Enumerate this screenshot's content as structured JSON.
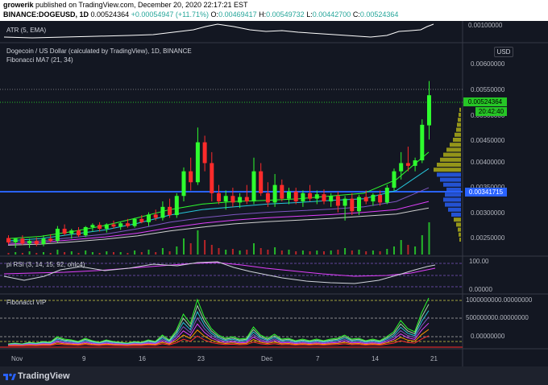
{
  "header": {
    "author": "growerik",
    "published_text": "published on TradingView.com, December 20, 2020 22:17:21 EST",
    "symbol": "BINANCE:DOGEUSD, 1D",
    "last_price": "0.00524364",
    "change": "+0.00054947 (+11.71%)",
    "open_label": "O:",
    "open": "0.00469417",
    "high_label": "H:",
    "high": "0.00549732",
    "low_label": "L:",
    "low": "0.00442700",
    "close_label": "C:",
    "close": "0.00524364"
  },
  "atr_panel": {
    "label": "ATR (5, EMA)",
    "right_label": "0.00100000"
  },
  "main_panel": {
    "title": "Dogecoin / US Dollar (calculated by TradingView), 1D, BINANCE",
    "indicator": "Fibonacci MA7 (21, 34)",
    "currency_button": "USD",
    "price_badge": "0.00524364",
    "time_badge": "20:42:40",
    "poc_badge": "0.00341715",
    "y_labels": [
      "0.00600000",
      "0.00550000",
      "0.00500000",
      "0.00450000",
      "0.00400000",
      "0.00350000",
      "0.00300000",
      "0.00250000"
    ],
    "y_partial_label": "0."
  },
  "rsi_panel": {
    "label": "pi RSI (3, 14, 15, 92, ohlc4)",
    "top_label": "100.00",
    "bottom_label": "0.00000"
  },
  "vip_panel": {
    "label": "Fibonacci VIP",
    "top_label": "1000000000.00000000",
    "mid_label": "500000000.00000000",
    "bottom_label": "0.00000000"
  },
  "time_axis": [
    "Nov",
    "9",
    "16",
    "23",
    "Dec",
    "7",
    "14",
    "21"
  ],
  "footer": {
    "brand": "TradingView"
  },
  "colors": {
    "up": "#2efc2e",
    "down": "#ff2b2b",
    "background": "#131722",
    "poc": "#2962ff",
    "profile": "#b5b518"
  },
  "chart_data": {
    "type": "candlestick",
    "y_range": [
      0.0023,
      0.0062
    ],
    "candles": [
      {
        "o": 0.00263,
        "h": 0.00268,
        "l": 0.00252,
        "c": 0.00255
      },
      {
        "o": 0.00255,
        "h": 0.00262,
        "l": 0.00245,
        "c": 0.00262
      },
      {
        "o": 0.00262,
        "h": 0.00268,
        "l": 0.0025,
        "c": 0.00253
      },
      {
        "o": 0.00253,
        "h": 0.00262,
        "l": 0.00245,
        "c": 0.00258
      },
      {
        "o": 0.00258,
        "h": 0.00264,
        "l": 0.00248,
        "c": 0.00252
      },
      {
        "o": 0.00252,
        "h": 0.00268,
        "l": 0.00248,
        "c": 0.00262
      },
      {
        "o": 0.00262,
        "h": 0.0027,
        "l": 0.00255,
        "c": 0.00258
      },
      {
        "o": 0.00258,
        "h": 0.00285,
        "l": 0.00255,
        "c": 0.0028
      },
      {
        "o": 0.0028,
        "h": 0.00288,
        "l": 0.00268,
        "c": 0.00271
      },
      {
        "o": 0.00271,
        "h": 0.0028,
        "l": 0.00262,
        "c": 0.00277
      },
      {
        "o": 0.00277,
        "h": 0.00283,
        "l": 0.00265,
        "c": 0.00268
      },
      {
        "o": 0.00268,
        "h": 0.00285,
        "l": 0.00265,
        "c": 0.00283
      },
      {
        "o": 0.00283,
        "h": 0.0029,
        "l": 0.00275,
        "c": 0.00287
      },
      {
        "o": 0.00287,
        "h": 0.00292,
        "l": 0.00275,
        "c": 0.0028
      },
      {
        "o": 0.0028,
        "h": 0.0029,
        "l": 0.00273,
        "c": 0.00288
      },
      {
        "o": 0.00288,
        "h": 0.00295,
        "l": 0.0028,
        "c": 0.00284
      },
      {
        "o": 0.00284,
        "h": 0.00292,
        "l": 0.00278,
        "c": 0.0029
      },
      {
        "o": 0.0029,
        "h": 0.00298,
        "l": 0.00282,
        "c": 0.00285
      },
      {
        "o": 0.00285,
        "h": 0.003,
        "l": 0.00282,
        "c": 0.00298
      },
      {
        "o": 0.00298,
        "h": 0.00305,
        "l": 0.0029,
        "c": 0.00292
      },
      {
        "o": 0.00292,
        "h": 0.0031,
        "l": 0.00285,
        "c": 0.00306
      },
      {
        "o": 0.00306,
        "h": 0.00315,
        "l": 0.00295,
        "c": 0.003
      },
      {
        "o": 0.003,
        "h": 0.0033,
        "l": 0.00295,
        "c": 0.0032
      },
      {
        "o": 0.0032,
        "h": 0.00335,
        "l": 0.003,
        "c": 0.00305
      },
      {
        "o": 0.00305,
        "h": 0.00345,
        "l": 0.003,
        "c": 0.0034
      },
      {
        "o": 0.0034,
        "h": 0.00392,
        "l": 0.0033,
        "c": 0.00385
      },
      {
        "o": 0.00385,
        "h": 0.0041,
        "l": 0.0035,
        "c": 0.00365
      },
      {
        "o": 0.00365,
        "h": 0.00465,
        "l": 0.0036,
        "c": 0.00438
      },
      {
        "o": 0.00438,
        "h": 0.0045,
        "l": 0.00385,
        "c": 0.004
      },
      {
        "o": 0.004,
        "h": 0.0042,
        "l": 0.0033,
        "c": 0.00345
      },
      {
        "o": 0.00345,
        "h": 0.0036,
        "l": 0.00325,
        "c": 0.0033
      },
      {
        "o": 0.0033,
        "h": 0.0035,
        "l": 0.00315,
        "c": 0.0034
      },
      {
        "o": 0.0034,
        "h": 0.00355,
        "l": 0.0032,
        "c": 0.00328
      },
      {
        "o": 0.00328,
        "h": 0.00345,
        "l": 0.00318,
        "c": 0.00338
      },
      {
        "o": 0.00338,
        "h": 0.0036,
        "l": 0.00325,
        "c": 0.0033
      },
      {
        "o": 0.0033,
        "h": 0.0041,
        "l": 0.00325,
        "c": 0.00385
      },
      {
        "o": 0.00385,
        "h": 0.004,
        "l": 0.0034,
        "c": 0.00345
      },
      {
        "o": 0.00345,
        "h": 0.00365,
        "l": 0.0032,
        "c": 0.00328
      },
      {
        "o": 0.00328,
        "h": 0.0038,
        "l": 0.0032,
        "c": 0.0036
      },
      {
        "o": 0.0036,
        "h": 0.0037,
        "l": 0.0033,
        "c": 0.00335
      },
      {
        "o": 0.00335,
        "h": 0.00355,
        "l": 0.00325,
        "c": 0.00348
      },
      {
        "o": 0.00348,
        "h": 0.00355,
        "l": 0.00325,
        "c": 0.0033
      },
      {
        "o": 0.0033,
        "h": 0.0035,
        "l": 0.0032,
        "c": 0.00345
      },
      {
        "o": 0.00345,
        "h": 0.0036,
        "l": 0.0033,
        "c": 0.00335
      },
      {
        "o": 0.00335,
        "h": 0.0035,
        "l": 0.00325,
        "c": 0.00343
      },
      {
        "o": 0.00343,
        "h": 0.00352,
        "l": 0.00325,
        "c": 0.0033
      },
      {
        "o": 0.0033,
        "h": 0.00345,
        "l": 0.0032,
        "c": 0.0034
      },
      {
        "o": 0.0034,
        "h": 0.00348,
        "l": 0.0031,
        "c": 0.00322
      },
      {
        "o": 0.00322,
        "h": 0.0034,
        "l": 0.00295,
        "c": 0.00335
      },
      {
        "o": 0.00335,
        "h": 0.00345,
        "l": 0.00305,
        "c": 0.00312
      },
      {
        "o": 0.00312,
        "h": 0.00342,
        "l": 0.00305,
        "c": 0.00338
      },
      {
        "o": 0.00338,
        "h": 0.0035,
        "l": 0.00325,
        "c": 0.0033
      },
      {
        "o": 0.0033,
        "h": 0.00345,
        "l": 0.00322,
        "c": 0.00342
      },
      {
        "o": 0.00342,
        "h": 0.0035,
        "l": 0.00322,
        "c": 0.00328
      },
      {
        "o": 0.00328,
        "h": 0.0036,
        "l": 0.00325,
        "c": 0.00355
      },
      {
        "o": 0.00355,
        "h": 0.0039,
        "l": 0.0035,
        "c": 0.00385
      },
      {
        "o": 0.00385,
        "h": 0.0042,
        "l": 0.0037,
        "c": 0.004
      },
      {
        "o": 0.004,
        "h": 0.0043,
        "l": 0.00385,
        "c": 0.00395
      },
      {
        "o": 0.00395,
        "h": 0.0041,
        "l": 0.00385,
        "c": 0.00405
      },
      {
        "o": 0.00405,
        "h": 0.0048,
        "l": 0.004,
        "c": 0.0047
      },
      {
        "o": 0.00469,
        "h": 0.0055,
        "l": 0.00443,
        "c": 0.00524
      }
    ],
    "ma_lines": [
      {
        "color": "#2efc2e",
        "values": [
          0.00262,
          0.00266,
          0.00275,
          0.00286,
          0.003,
          0.00315,
          0.00325,
          0.0033,
          0.00332,
          0.00335,
          0.0034,
          0.00345,
          0.0037,
          0.0042
        ]
      },
      {
        "color": "#26c6da",
        "values": [
          0.00258,
          0.00262,
          0.0027,
          0.00278,
          0.0029,
          0.00305,
          0.00315,
          0.0032,
          0.00325,
          0.00328,
          0.00332,
          0.00335,
          0.0035,
          0.0039
        ]
      },
      {
        "color": "#7e57c2",
        "values": [
          0.00255,
          0.00258,
          0.00264,
          0.0027,
          0.0028,
          0.00292,
          0.003,
          0.00306,
          0.0031,
          0.00313,
          0.00316,
          0.0032,
          0.0033,
          0.00355
        ]
      },
      {
        "color": "#e040fb",
        "values": [
          0.00252,
          0.00255,
          0.0026,
          0.00265,
          0.00272,
          0.00282,
          0.0029,
          0.00296,
          0.003,
          0.00303,
          0.00306,
          0.0031,
          0.00315,
          0.0033
        ]
      },
      {
        "color": "#cfcfcf",
        "values": [
          0.0025,
          0.00252,
          0.00256,
          0.00261,
          0.00267,
          0.00276,
          0.00283,
          0.00289,
          0.00293,
          0.00296,
          0.00299,
          0.00303,
          0.00307,
          0.00318
        ]
      }
    ]
  }
}
